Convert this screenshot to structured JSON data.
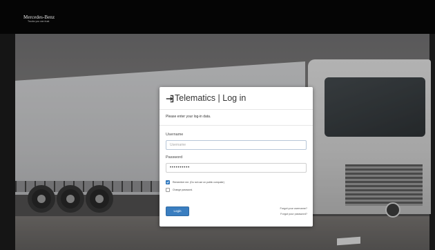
{
  "header": {
    "brand_name": "Mercedes-Benz",
    "brand_tagline": "Trucks you can trust"
  },
  "login": {
    "title_icon": "sign-in-icon",
    "title": "Telematics | Log in",
    "subtitle": "Please enter your log-in data.",
    "username_label": "Username",
    "username_placeholder": "Username",
    "username_value": "",
    "password_label": "Password",
    "password_value": "••••••••••",
    "remember_label": "Remember me. (Do not use on public computer)",
    "remember_checked": true,
    "change_password_label": "Change password.",
    "change_password_checked": false,
    "login_button": "Login",
    "forgot_username": "Forgot your username?",
    "forgot_password": "Forgot your password?"
  },
  "colors": {
    "accent": "#3a7ec0",
    "header_bg": "#050505",
    "card_bg": "#ffffff"
  }
}
